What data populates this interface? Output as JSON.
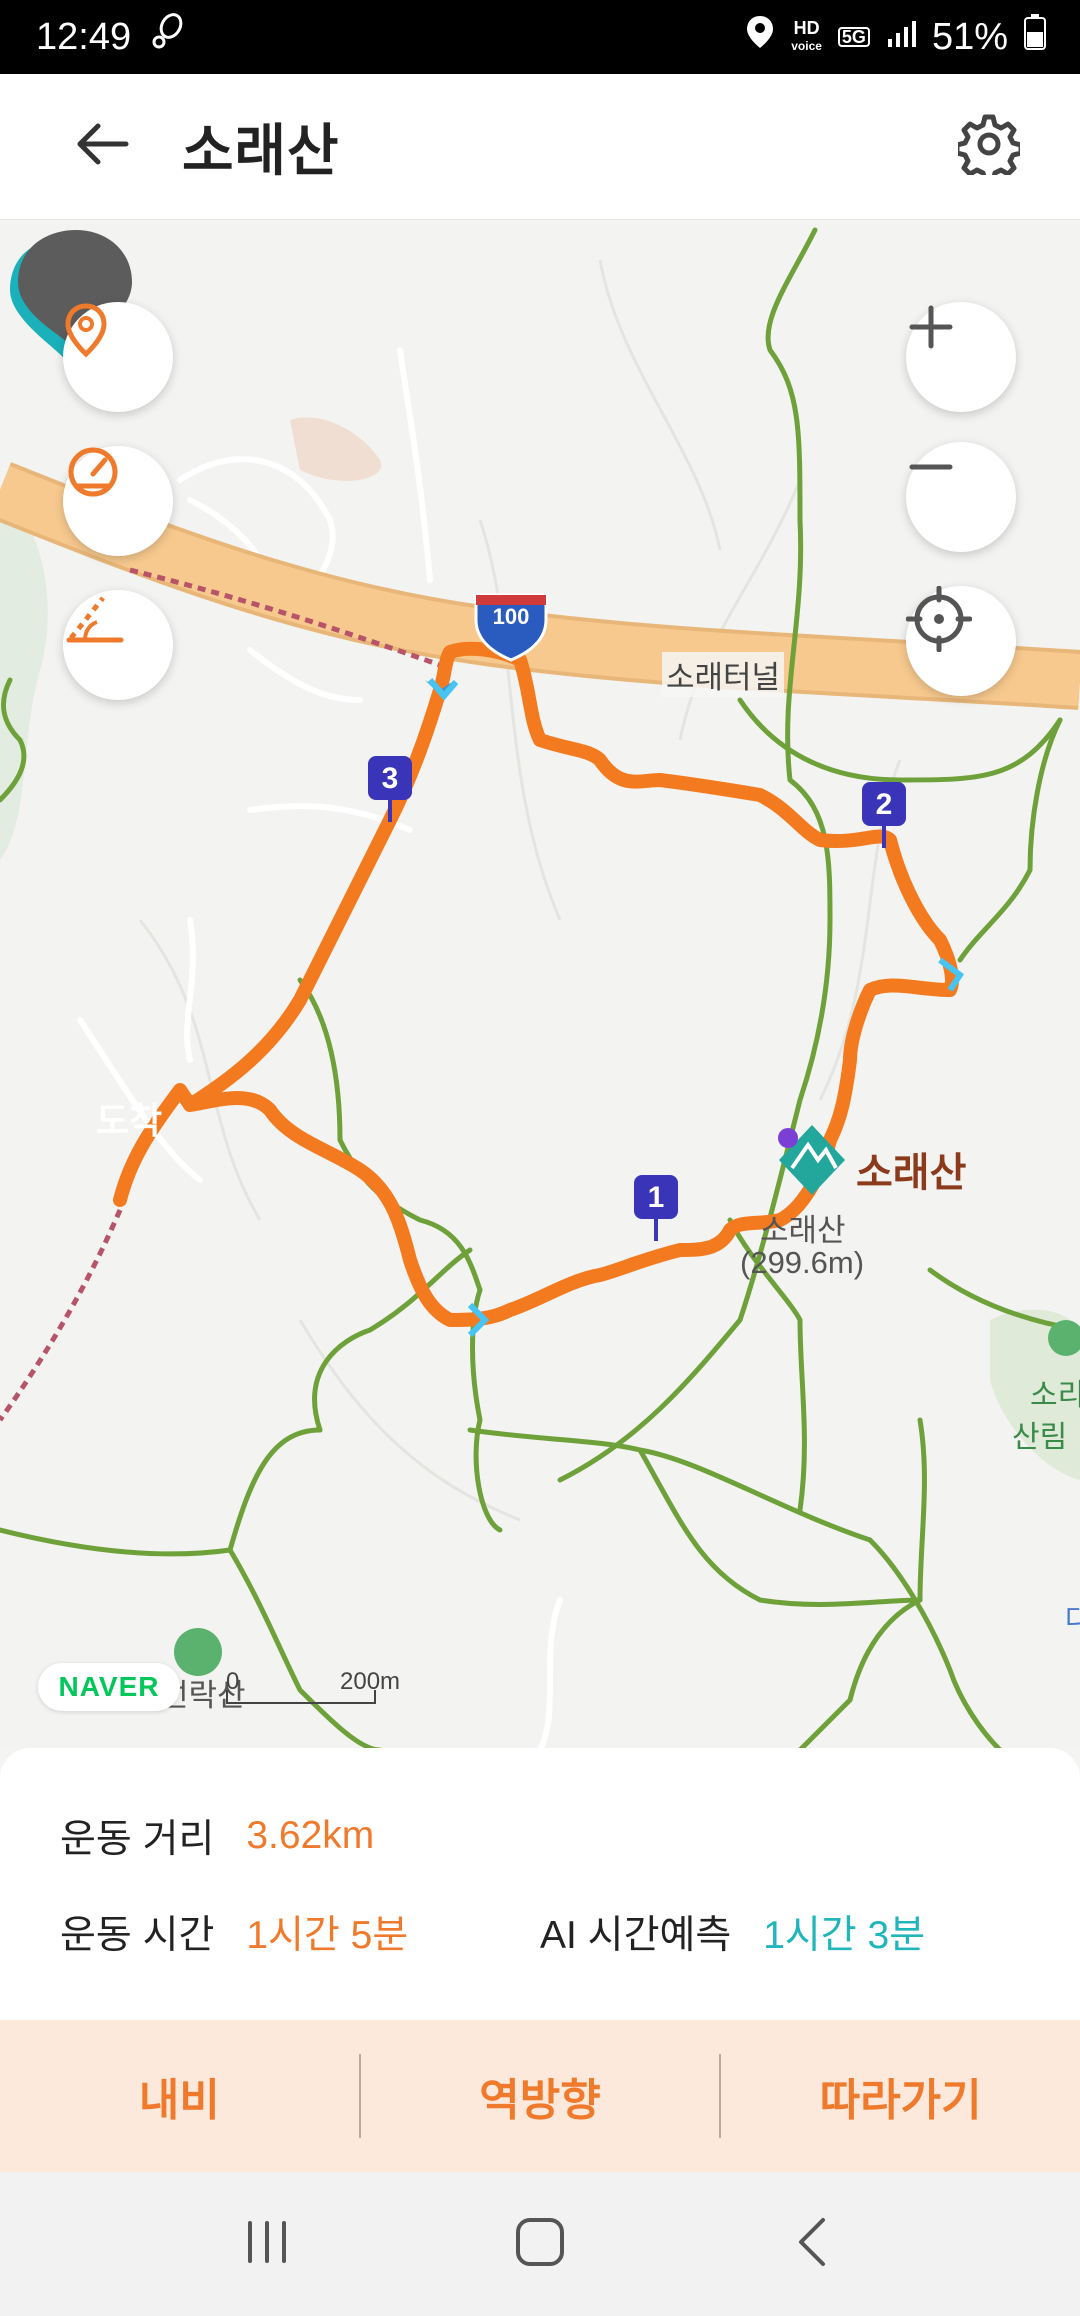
{
  "status_bar": {
    "time": "12:49",
    "battery": "51%",
    "hd_label": "HD",
    "voice_label": "voice",
    "network_label": "5G",
    "icons": [
      "step-counter-icon",
      "location-icon",
      "hd-voice-icon",
      "5g-icon",
      "signal-icon",
      "battery-icon"
    ]
  },
  "header": {
    "title": "소래산",
    "icons": [
      "back-arrow-icon",
      "gear-icon"
    ]
  },
  "map": {
    "controls_left": [
      "location-pin-icon",
      "speedometer-icon",
      "slope-icon"
    ],
    "controls_right": [
      "zoom-in-icon",
      "zoom-out-icon",
      "current-location-icon"
    ],
    "highway_shield": "100",
    "tunnel_label": "소래터널",
    "peak_name": "소래산",
    "peak_label": "소래산",
    "peak_elevation": "(299.6m)",
    "nearby_label_1": "소리",
    "nearby_label_2": "산림",
    "nearby_label_3": "선락산",
    "cut_label": "다",
    "arrival_label": "도착",
    "waypoints": [
      "1",
      "2",
      "3"
    ],
    "provider_logo": "NAVER",
    "scale_start": "0",
    "scale_end": "200m",
    "route_color": "#f47a20",
    "trail_color": "#6fa13a",
    "waypoint_color": "#3a35b8"
  },
  "stats": {
    "distance_label": "운동 거리",
    "distance_value": "3.62km",
    "time_label": "운동 시간",
    "time_value": "1시간 5분",
    "ai_label": "AI 시간예측",
    "ai_value": "1시간 3분"
  },
  "actions": {
    "navi": "내비",
    "reverse": "역방향",
    "follow": "따라가기"
  },
  "nav_bar": {
    "icons": [
      "recent-apps-icon",
      "home-icon",
      "back-icon"
    ]
  }
}
